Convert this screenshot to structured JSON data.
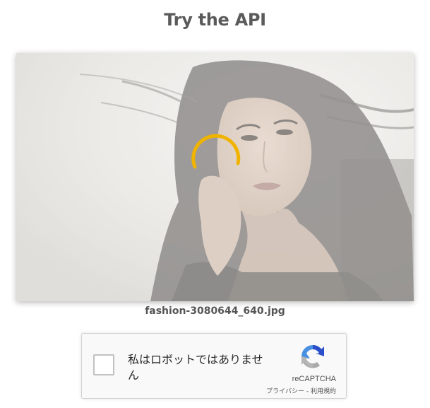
{
  "page": {
    "title": "Try the API"
  },
  "preview": {
    "filename": "fashion-3080644_640.jpg",
    "spinner_color": "#f0b400"
  },
  "recaptcha": {
    "label": "私はロボットではありません",
    "brand": "reCAPTCHA",
    "privacy_link": "プライバシー",
    "separator": " - ",
    "terms_link": "利用規約"
  }
}
